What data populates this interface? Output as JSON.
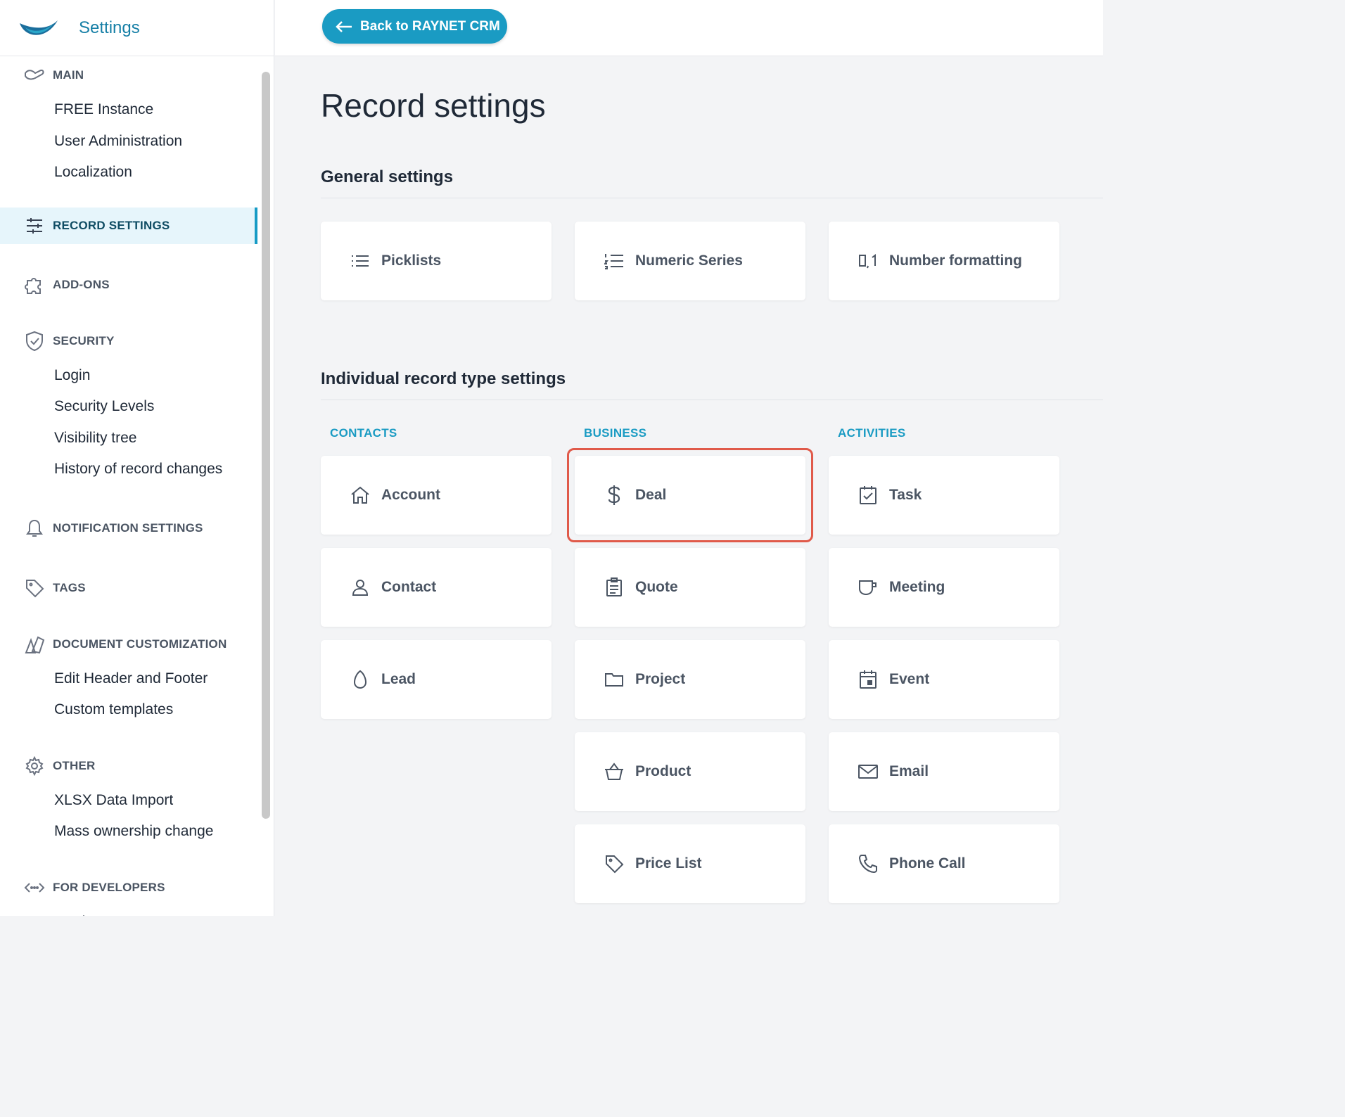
{
  "app": {
    "title": "Settings"
  },
  "topbar": {
    "back_label": "Back to RAYNET CRM"
  },
  "sidebar": {
    "groups": [
      {
        "id": "main",
        "label": "MAIN",
        "icon": "hand-icon",
        "items": [
          "FREE Instance",
          "User Administration",
          "Localization"
        ]
      },
      {
        "id": "record",
        "label": "RECORD SETTINGS",
        "icon": "sliders-icon",
        "items": [],
        "active": true
      },
      {
        "id": "addons",
        "label": "ADD-ONS",
        "icon": "puzzle-icon",
        "items": []
      },
      {
        "id": "security",
        "label": "SECURITY",
        "icon": "shield-check-icon",
        "items": [
          "Login",
          "Security Levels",
          "Visibility tree",
          "History of record changes"
        ]
      },
      {
        "id": "notif",
        "label": "NOTIFICATION SETTINGS",
        "icon": "bell-icon",
        "items": []
      },
      {
        "id": "tags",
        "label": "TAGS",
        "icon": "tag-icon",
        "items": []
      },
      {
        "id": "doc",
        "label": "DOCUMENT CUSTOMIZATION",
        "icon": "swatch-icon",
        "items": [
          "Edit Header and Footer",
          "Custom templates"
        ]
      },
      {
        "id": "other",
        "label": "OTHER",
        "icon": "gear-icon",
        "items": [
          "XLSX Data Import",
          "Mass ownership change"
        ]
      },
      {
        "id": "dev",
        "label": "FOR DEVELOPERS",
        "icon": "code-icon",
        "items": [
          "API keys"
        ]
      }
    ]
  },
  "main": {
    "title": "Record settings",
    "general": {
      "title": "General settings",
      "cards": [
        {
          "label": "Picklists",
          "icon": "list-icon"
        },
        {
          "label": "Numeric Series",
          "icon": "numbered-list-icon"
        },
        {
          "label": "Number formatting",
          "icon": "decimal-icon"
        }
      ]
    },
    "individual": {
      "title": "Individual record type settings",
      "columns": [
        {
          "heading": "CONTACTS",
          "cards": [
            {
              "label": "Account",
              "icon": "house-icon"
            },
            {
              "label": "Contact",
              "icon": "person-icon"
            },
            {
              "label": "Lead",
              "icon": "egg-icon"
            }
          ]
        },
        {
          "heading": "BUSINESS",
          "cards": [
            {
              "label": "Deal",
              "icon": "dollar-icon",
              "highlighted": true
            },
            {
              "label": "Quote",
              "icon": "clipboard-icon"
            },
            {
              "label": "Project",
              "icon": "folder-icon"
            },
            {
              "label": "Product",
              "icon": "basket-icon"
            },
            {
              "label": "Price List",
              "icon": "tag-icon"
            }
          ]
        },
        {
          "heading": "ACTIVITIES",
          "cards": [
            {
              "label": "Task",
              "icon": "checkbox-icon"
            },
            {
              "label": "Meeting",
              "icon": "cup-icon"
            },
            {
              "label": "Event",
              "icon": "calendar-icon"
            },
            {
              "label": "Email",
              "icon": "envelope-icon"
            },
            {
              "label": "Phone Call",
              "icon": "phone-icon"
            }
          ]
        }
      ]
    }
  },
  "colors": {
    "accent": "#1a9bc3",
    "highlight": "#e05a4a",
    "active_bg": "#e6f5fb"
  }
}
